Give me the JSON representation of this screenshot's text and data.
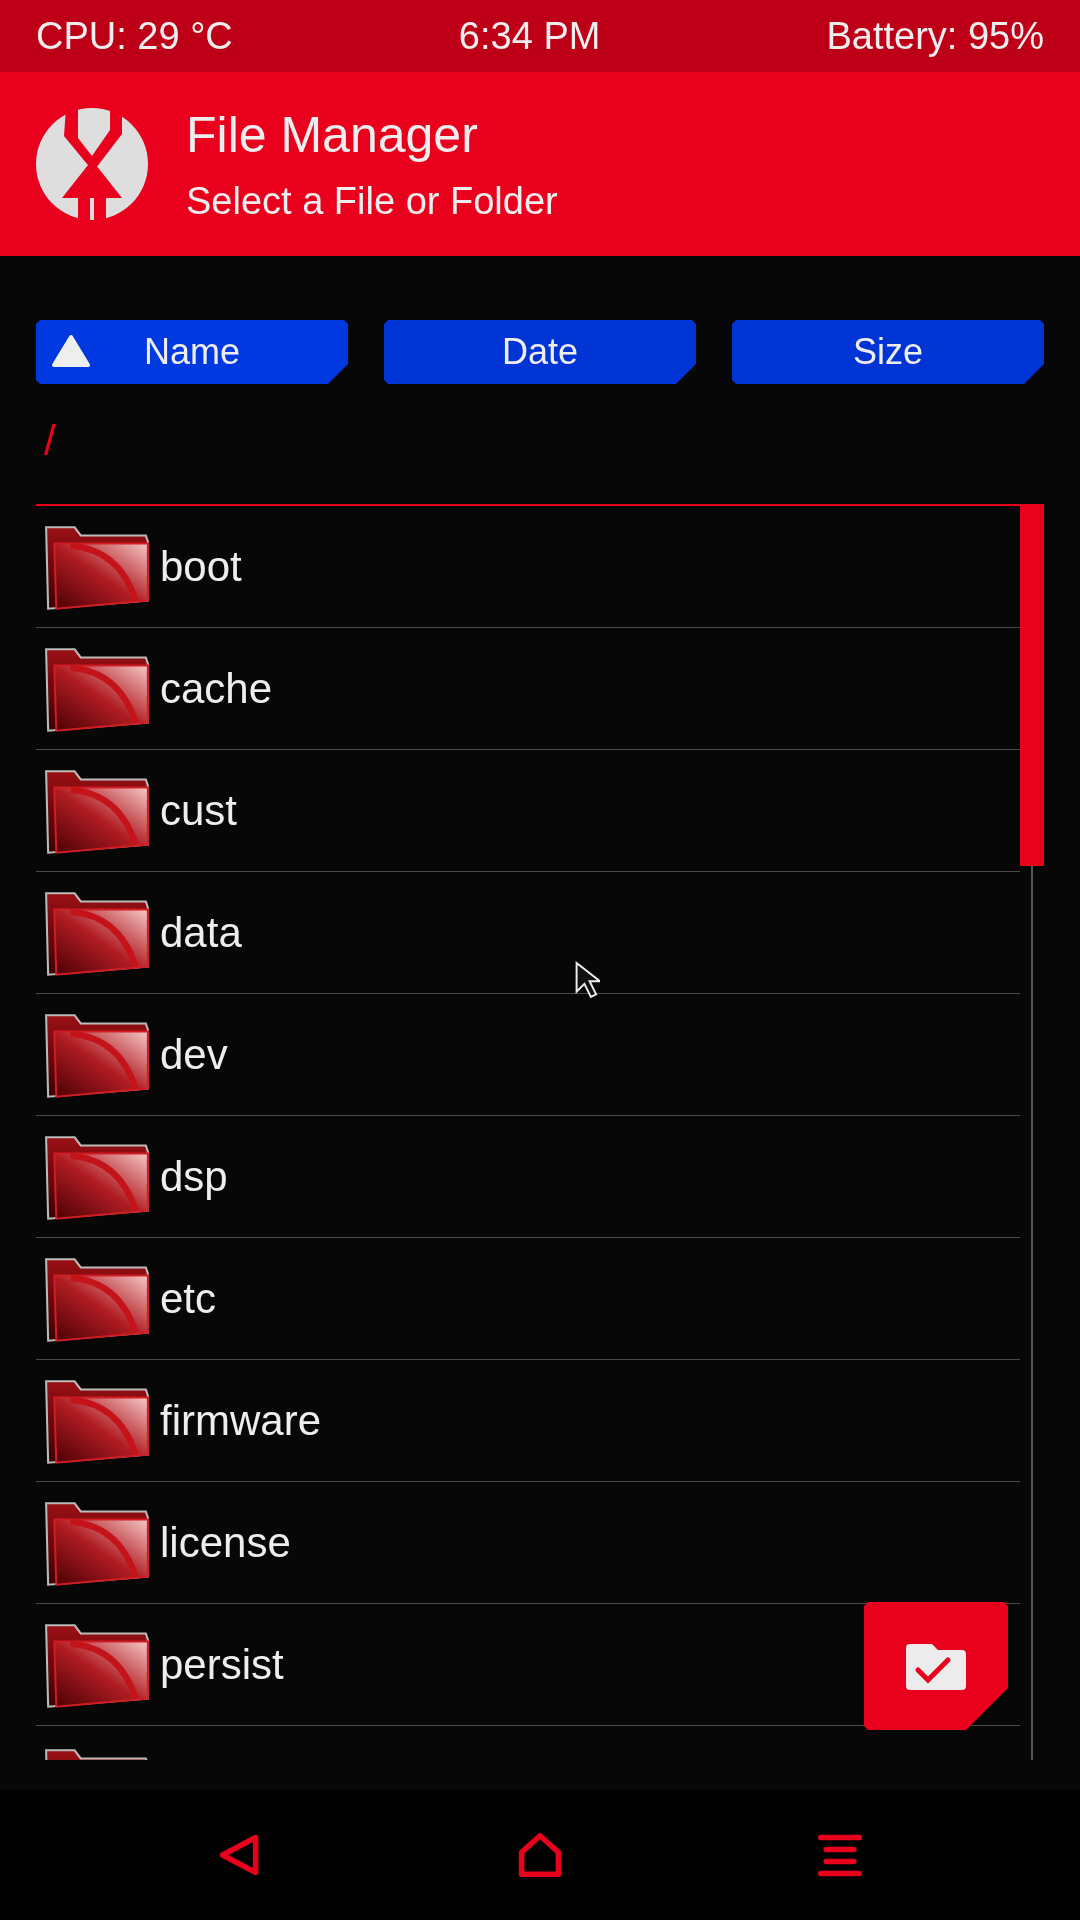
{
  "status_bar": {
    "cpu": "CPU: 29 °C",
    "time": "6:34 PM",
    "battery": "Battery: 95%"
  },
  "header": {
    "title": "File Manager",
    "subtitle": "Select a File or Folder"
  },
  "sort_buttons": [
    {
      "label": "Name",
      "selected": true
    },
    {
      "label": "Date",
      "selected": false
    },
    {
      "label": "Size",
      "selected": false
    }
  ],
  "path": "/",
  "folders": [
    {
      "name": "boot"
    },
    {
      "name": "cache"
    },
    {
      "name": "cust"
    },
    {
      "name": "data"
    },
    {
      "name": "dev"
    },
    {
      "name": "dsp"
    },
    {
      "name": "etc"
    },
    {
      "name": "firmware"
    },
    {
      "name": "license"
    },
    {
      "name": "persist"
    }
  ]
}
